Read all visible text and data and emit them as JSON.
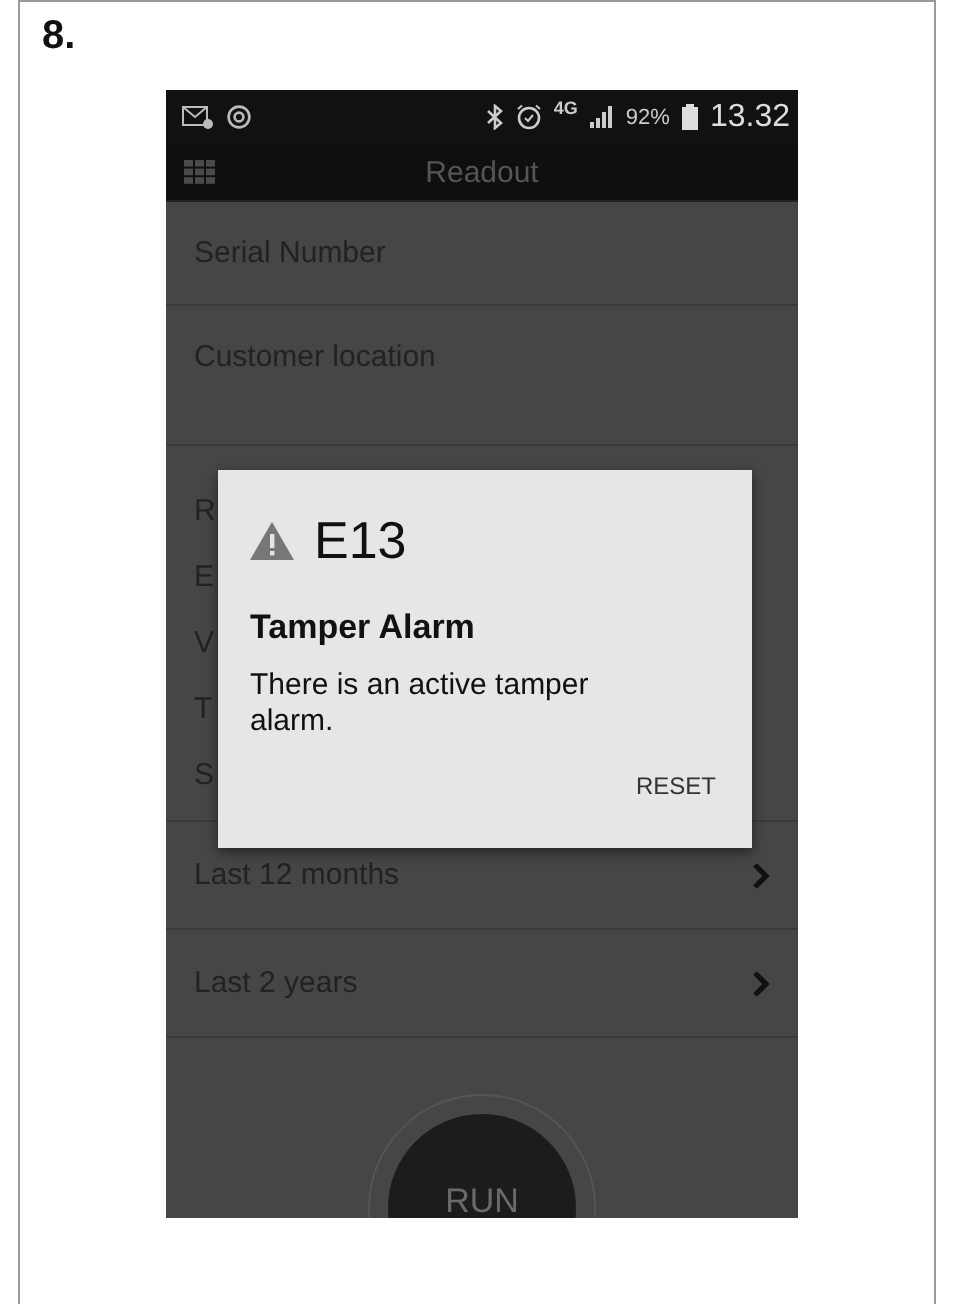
{
  "page": {
    "step_number": "8."
  },
  "status_bar": {
    "network": "4G",
    "battery": "92%",
    "time": "13.32"
  },
  "app_bar": {
    "title": "Readout"
  },
  "rows": [
    {
      "label": "Serial Number",
      "kind": "plain"
    },
    {
      "label": "Customer location",
      "kind": "tall"
    }
  ],
  "covered_lines": [
    "R",
    "E",
    "V",
    "T",
    "S"
  ],
  "nav_rows": [
    {
      "label": "Last 12 months"
    },
    {
      "label": "Last 2 years"
    }
  ],
  "run_button": {
    "label": "RUN"
  },
  "dialog": {
    "code": "E13",
    "title": "Tamper Alarm",
    "message": "There is an active tamper alarm.",
    "button": "RESET"
  }
}
